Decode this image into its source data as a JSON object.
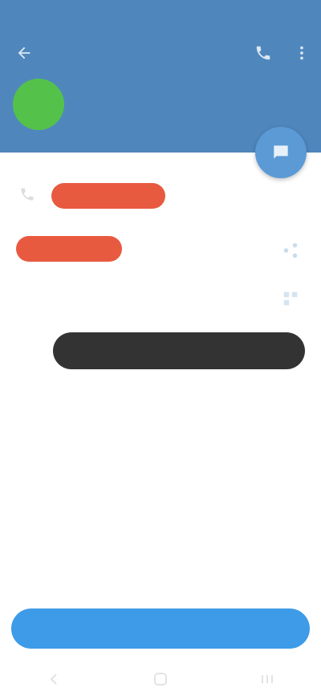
{
  "status_bar": {
    "time": "",
    "indicators": ""
  },
  "toolbar": {
    "back_icon": "arrow-back-icon",
    "actions": [
      "phone-icon",
      "more-vert-icon"
    ]
  },
  "profile": {
    "name": "",
    "status": "",
    "avatar_color": "#54c24a"
  },
  "fab": {
    "icon": "chat-icon"
  },
  "info": {
    "phone_value": "",
    "phone_sub": "",
    "username_value": "",
    "username_sub": ""
  },
  "toast": {
    "text": ""
  },
  "empty_state": {
    "title": "",
    "description": ""
  },
  "action_button": {
    "label": ""
  },
  "colors": {
    "header": "#4f87bd",
    "accent": "#3d9be7",
    "redaction": "#e85a40",
    "toast": "#333333"
  },
  "nav_bar": {
    "buttons": [
      "back-icon",
      "home-icon",
      "recents-icon"
    ]
  }
}
